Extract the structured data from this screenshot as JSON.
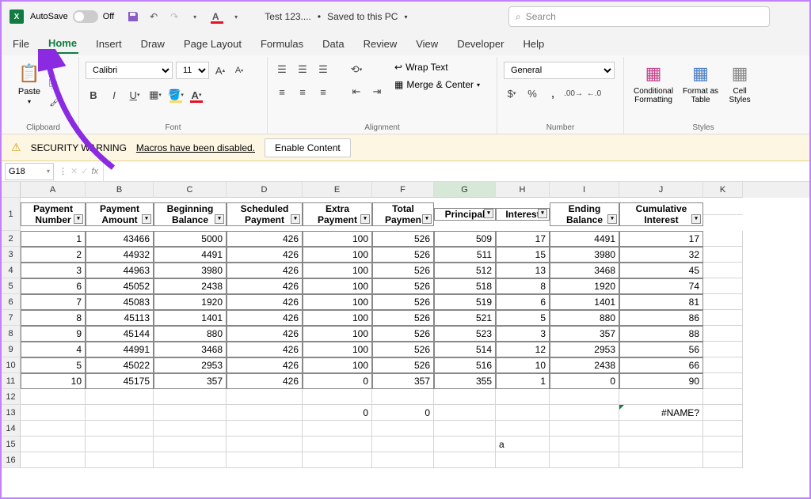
{
  "titlebar": {
    "autosave_label": "AutoSave",
    "autosave_state": "Off",
    "filename": "Test 123....",
    "save_status": "Saved to this PC",
    "search_placeholder": "Search"
  },
  "tabs": [
    "File",
    "Home",
    "Insert",
    "Draw",
    "Page Layout",
    "Formulas",
    "Data",
    "Review",
    "View",
    "Developer",
    "Help"
  ],
  "active_tab": "Home",
  "ribbon": {
    "clipboard": {
      "label": "Clipboard",
      "paste": "Paste"
    },
    "font": {
      "label": "Font",
      "name": "Calibri",
      "size": "11"
    },
    "alignment": {
      "label": "Alignment",
      "wrap": "Wrap Text",
      "merge": "Merge & Center"
    },
    "number": {
      "label": "Number",
      "format": "General"
    },
    "styles": {
      "label": "Styles",
      "conditional": "Conditional\nFormatting",
      "format_table": "Format as\nTable",
      "cell_styles": "Cell\nStyles"
    }
  },
  "warning": {
    "title": "SECURITY WARNING",
    "msg": "Macros have been disabled.",
    "btn": "Enable Content"
  },
  "formula": {
    "name_box": "G18",
    "fx": "fx"
  },
  "columns": [
    "A",
    "B",
    "C",
    "D",
    "E",
    "F",
    "G",
    "H",
    "I",
    "J",
    "K"
  ],
  "col_widths": [
    "cw-A",
    "cw-B",
    "cw-C",
    "cw-D",
    "cw-E",
    "cw-F",
    "cw-G",
    "cw-H",
    "cw-I",
    "cw-J",
    "cw-K"
  ],
  "headers": [
    "Payment Number",
    "Payment Amount",
    "Beginning Balance",
    "Scheduled Payment",
    "Extra Payment",
    "Total Paymen",
    "Principal",
    "Interest",
    "Ending Balance",
    "Cumulative Interest"
  ],
  "rows": [
    [
      "1",
      "43466",
      "5000",
      "426",
      "100",
      "526",
      "509",
      "17",
      "4491",
      "17"
    ],
    [
      "2",
      "44932",
      "4491",
      "426",
      "100",
      "526",
      "511",
      "15",
      "3980",
      "32"
    ],
    [
      "3",
      "44963",
      "3980",
      "426",
      "100",
      "526",
      "512",
      "13",
      "3468",
      "45"
    ],
    [
      "6",
      "45052",
      "2438",
      "426",
      "100",
      "526",
      "518",
      "8",
      "1920",
      "74"
    ],
    [
      "7",
      "45083",
      "1920",
      "426",
      "100",
      "526",
      "519",
      "6",
      "1401",
      "81"
    ],
    [
      "8",
      "45113",
      "1401",
      "426",
      "100",
      "526",
      "521",
      "5",
      "880",
      "86"
    ],
    [
      "9",
      "45144",
      "880",
      "426",
      "100",
      "526",
      "523",
      "3",
      "357",
      "88"
    ],
    [
      "4",
      "44991",
      "3468",
      "426",
      "100",
      "526",
      "514",
      "12",
      "2953",
      "56"
    ],
    [
      "5",
      "45022",
      "2953",
      "426",
      "100",
      "526",
      "516",
      "10",
      "2438",
      "66"
    ],
    [
      "10",
      "45175",
      "357",
      "426",
      "0",
      "357",
      "355",
      "1",
      "0",
      "90"
    ]
  ],
  "row13": {
    "E": "0",
    "F": "0",
    "J": "#NAME?"
  },
  "row15": {
    "H": "a"
  },
  "selected_cell": "G18"
}
